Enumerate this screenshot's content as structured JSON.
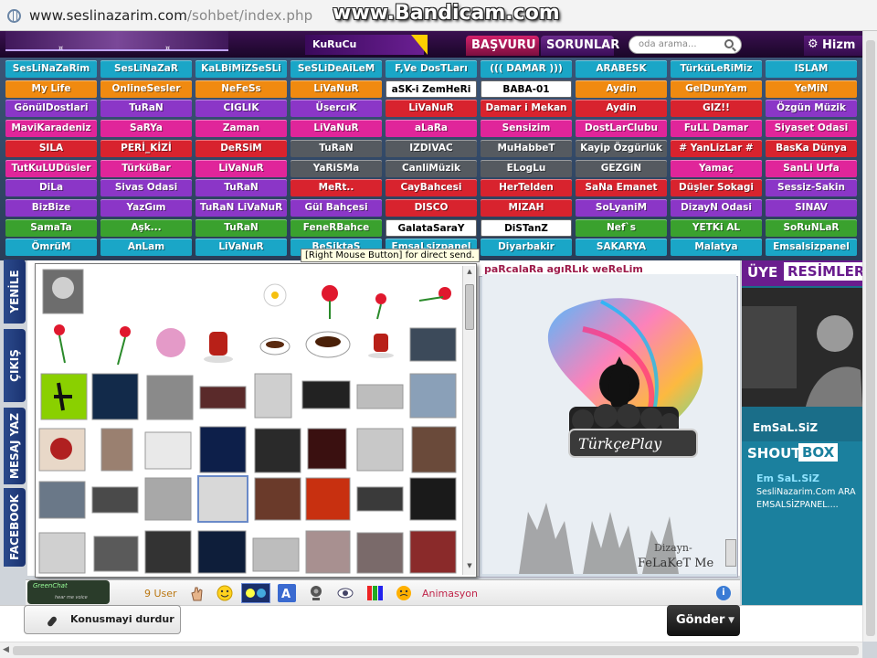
{
  "browser": {
    "url_host": "www.seslinazarim.com",
    "url_path": "/sohbet/index.php",
    "watermark": "www.Bandicam.com"
  },
  "header": {
    "kurucu": "KuRuCu",
    "basvuru": "BAŞVURU",
    "sorunlar": "SORUNLAR",
    "search_placeholder": "oda arama...",
    "hizmet": "Hizm",
    "logo_dots": "¤",
    "logo_dots2": "¤"
  },
  "rooms": [
    [
      {
        "t": "SesLiNaZaRim",
        "c": "#1aa6c7"
      },
      {
        "t": "SesLiNaZaR",
        "c": "#1aa6c7"
      },
      {
        "t": "KaLBiMiZSeSLi",
        "c": "#1aa6c7"
      },
      {
        "t": "SeSLiDeAiLeM",
        "c": "#1aa6c7"
      },
      {
        "t": "F,Ve DosTLarı",
        "c": "#1aa6c7"
      },
      {
        "t": "((( DAMAR )))",
        "c": "#1aa6c7"
      },
      {
        "t": "ARABESK",
        "c": "#1aa6c7"
      },
      {
        "t": "TürküLeRiMiz",
        "c": "#1aa6c7"
      },
      {
        "t": "ISLAM",
        "c": "#1aa6c7"
      }
    ],
    [
      {
        "t": "My Life",
        "c": "#f08a10"
      },
      {
        "t": "OnlineSesler",
        "c": "#f08a10"
      },
      {
        "t": "NeFeSs",
        "c": "#f08a10"
      },
      {
        "t": "LiVaNuR",
        "c": "#f08a10"
      },
      {
        "t": "aSK-i ZemHeRi",
        "c": "#ffffff",
        "fg": "#000"
      },
      {
        "t": "BABA-01",
        "c": "#ffffff",
        "fg": "#000"
      },
      {
        "t": "Aydin",
        "c": "#f08a10"
      },
      {
        "t": "GelDunYam",
        "c": "#f08a10"
      },
      {
        "t": "YeMiN",
        "c": "#f08a10"
      }
    ],
    [
      {
        "t": "GönülDostlari",
        "c": "#8b36c7"
      },
      {
        "t": "TuRaN",
        "c": "#8b36c7"
      },
      {
        "t": "CIGLIK",
        "c": "#8b36c7"
      },
      {
        "t": "ÜsercıK",
        "c": "#8b36c7"
      },
      {
        "t": "LiVaNuR",
        "c": "#d8232e"
      },
      {
        "t": "Damar i Mekan",
        "c": "#d8232e"
      },
      {
        "t": "Aydin",
        "c": "#d8232e"
      },
      {
        "t": "GIZ!!",
        "c": "#d8232e"
      },
      {
        "t": "Özgün Müzik",
        "c": "#8b36c7"
      }
    ],
    [
      {
        "t": "MaviKaradeniz",
        "c": "#e0259a"
      },
      {
        "t": "SaRYa",
        "c": "#e0259a"
      },
      {
        "t": "Zaman",
        "c": "#e0259a"
      },
      {
        "t": "LiVaNuR",
        "c": "#e0259a"
      },
      {
        "t": "aLaRa",
        "c": "#e0259a"
      },
      {
        "t": "Sensizim",
        "c": "#e0259a"
      },
      {
        "t": "DostLarClubu",
        "c": "#e0259a"
      },
      {
        "t": "FuLL Damar",
        "c": "#e0259a"
      },
      {
        "t": "Siyaset Odasi",
        "c": "#e0259a"
      }
    ],
    [
      {
        "t": "SILA",
        "c": "#d8232e"
      },
      {
        "t": "PERİ_KİZİ",
        "c": "#d8232e"
      },
      {
        "t": "DeRSiM",
        "c": "#d8232e"
      },
      {
        "t": "TuRaN",
        "c": "#555a60"
      },
      {
        "t": "IZDIVAC",
        "c": "#555a60"
      },
      {
        "t": "MuHabbeT",
        "c": "#555a60"
      },
      {
        "t": "Kayip Özgürlük",
        "c": "#555a60"
      },
      {
        "t": "# YanLizLar #",
        "c": "#d8232e"
      },
      {
        "t": "BasKa Dünya",
        "c": "#d8232e"
      }
    ],
    [
      {
        "t": "TutKuLUDüsler",
        "c": "#e0259a"
      },
      {
        "t": "TürküBar",
        "c": "#e0259a"
      },
      {
        "t": "LiVaNuR",
        "c": "#e0259a"
      },
      {
        "t": "YaRiSMa",
        "c": "#555a60"
      },
      {
        "t": "CanliMüzik",
        "c": "#555a60"
      },
      {
        "t": "ELogLu",
        "c": "#555a60"
      },
      {
        "t": "GEZGiN",
        "c": "#555a60"
      },
      {
        "t": "Yamaç",
        "c": "#e0259a"
      },
      {
        "t": "SanLi Urfa",
        "c": "#e0259a"
      }
    ],
    [
      {
        "t": "DiLa",
        "c": "#8b36c7"
      },
      {
        "t": "Sivas Odasi",
        "c": "#8b36c7"
      },
      {
        "t": "TuRaN",
        "c": "#8b36c7"
      },
      {
        "t": "MeRt..",
        "c": "#d8232e"
      },
      {
        "t": "CayBahcesi",
        "c": "#d8232e"
      },
      {
        "t": "HerTelden",
        "c": "#d8232e"
      },
      {
        "t": "SaNa Emanet",
        "c": "#d8232e"
      },
      {
        "t": "Düşler Sokagi",
        "c": "#d8232e"
      },
      {
        "t": "Sessiz-Sakin",
        "c": "#8b36c7"
      }
    ],
    [
      {
        "t": "BizBize",
        "c": "#8b36c7"
      },
      {
        "t": "YazGım",
        "c": "#8b36c7"
      },
      {
        "t": "TuRaN LiVaNuR",
        "c": "#8b36c7"
      },
      {
        "t": "Gül Bahçesi",
        "c": "#8b36c7"
      },
      {
        "t": "DISCO",
        "c": "#d8232e"
      },
      {
        "t": "MIZAH",
        "c": "#d8232e"
      },
      {
        "t": "SoLyaniM",
        "c": "#8b36c7"
      },
      {
        "t": "DizayN Odasi",
        "c": "#8b36c7"
      },
      {
        "t": "SINAV",
        "c": "#8b36c7"
      }
    ],
    [
      {
        "t": "SamaTa",
        "c": "#3aa12e"
      },
      {
        "t": "Aşk...",
        "c": "#3aa12e"
      },
      {
        "t": "TuRaN",
        "c": "#3aa12e"
      },
      {
        "t": "FeneRBahce",
        "c": "#3aa12e"
      },
      {
        "t": "GalataSaraY",
        "c": "#ffffff",
        "fg": "#000"
      },
      {
        "t": "DiSTanZ",
        "c": "#ffffff",
        "fg": "#000"
      },
      {
        "t": "Nef`s",
        "c": "#3aa12e"
      },
      {
        "t": "YETKi AL",
        "c": "#3aa12e"
      },
      {
        "t": "SoRuNLaR",
        "c": "#3aa12e"
      }
    ],
    [
      {
        "t": "ÖmrüM",
        "c": "#1aa6c7"
      },
      {
        "t": "AnLam",
        "c": "#1aa6c7"
      },
      {
        "t": "LiVaNuR",
        "c": "#1aa6c7"
      },
      {
        "t": "BeSiktaS",
        "c": "#1aa6c7"
      },
      {
        "t": "EmsaLsizpanel",
        "c": "#1aa6c7"
      },
      {
        "t": "Diyarbakir",
        "c": "#1aa6c7"
      },
      {
        "t": "SAKARYA",
        "c": "#1aa6c7"
      },
      {
        "t": "Malatya",
        "c": "#1aa6c7"
      },
      {
        "t": "Emsalsizpanel",
        "c": "#1aa6c7"
      }
    ]
  ],
  "side_tabs": {
    "yenile": "YENİLE",
    "cikis": "ÇIKIŞ",
    "mesaj": "MESAJ YAZ",
    "facebook": "FACEBOOK"
  },
  "tooltip": "[Right Mouse Button] for direct send.",
  "chat": {
    "title": "paRcalaRa agıRLık weReLim",
    "poster_brand": "TürkçePlay",
    "poster_sig1": "Dizayn-",
    "poster_sig2": "FeLaKeT Me"
  },
  "right": {
    "uye": "ÜYE",
    "resimler": "RESİMLER",
    "emsal": "EmSaL.SiZ",
    "shout": "SHOUT",
    "box": "BOX",
    "shout_name": "Em SaL.SiZ",
    "shout_msg1": "SesliNazarim.Com ARA",
    "shout_msg2": "EMSALSİZPANEL...."
  },
  "toolbar": {
    "users": "9 User",
    "anim": "Animasyon",
    "logo": "GreenChat",
    "logo_sub": "hear me voice"
  },
  "bottom": {
    "konus": "Konusmayi durdur",
    "gonder": "Gönder"
  },
  "colors": {
    "accent": "#6a1d8e",
    "teal": "#1b809e"
  }
}
